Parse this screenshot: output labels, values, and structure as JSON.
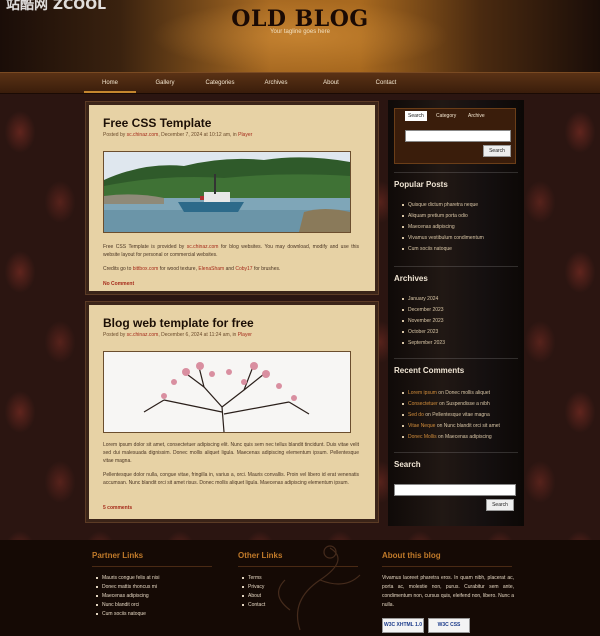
{
  "header": {
    "watermark": "站酷网 ZCOOL",
    "title": "OLD BLOG",
    "tagline": "Your tagline goes here"
  },
  "nav": [
    "Home",
    "Gallery",
    "Categories",
    "Archives",
    "About",
    "Contact"
  ],
  "posts": [
    {
      "title": "Free CSS Template",
      "meta_prefix": "Posted by ",
      "author": "sc.chinaz.com",
      "meta_date": ", December 7, 2024 at 10:12 am, in ",
      "category": "Player",
      "body1_prefix": "Free CSS Template is provided by ",
      "body1_link": "sc.chinaz.com",
      "body1_suffix": " for blog websites. You may download, modify and use this website layout for personal or commercial websites.",
      "credits_prefix": "Credits go to ",
      "credits_link1": "bittbox.com",
      "credits_mid": " for wood texture, ",
      "credits_link2": "ElenaSham",
      "credits_and": " and ",
      "credits_link3": "Coby17",
      "credits_suffix": " for brushes.",
      "comments": "No Comment"
    },
    {
      "title": "Blog web template for free",
      "meta_prefix": "Posted by ",
      "author": "sc.chinaz.com",
      "meta_date": ", December 6, 2024 at 11:24 am, in ",
      "category": "Player",
      "body1": "Lorem ipsum dolor sit amet, consectetuer adipiscing elit. Nunc quis sem nec tellus blandit tincidunt. Duis vitae velit sed dui malesuada dignissim. Donec mollis aliquet ligula. Maecenas adipiscing elementum ipsum. Pellentesque vitae magna.",
      "body2": "Pellentesque dolor nulla, congue vitae, fringilla in, varius a, orci. Mauris convallis. Proin vel libero id erat venenatis accumsan. Nunc blandit orci sit amet risus. Donec mollis aliquet ligula. Maecenas adipiscing elementum ipsum.",
      "comments": "5 comments"
    }
  ],
  "sidebar": {
    "tabs": [
      "Search",
      "Category",
      "Archive"
    ],
    "search_button": "Search",
    "popular_title": "Popular Posts",
    "popular": [
      "Quisque dictum pharetra neque",
      "Aliquam pretium porta odio",
      "Maecenas adipiscing",
      "Vivamus vestibulum condimentum",
      "Cum sociis natoque"
    ],
    "archives_title": "Archives",
    "archives": [
      "January 2024",
      "December 2023",
      "November 2023",
      "October 2023",
      "September 2023"
    ],
    "comments_title": "Recent Comments",
    "comments": [
      {
        "who": "Lorem ipsum",
        "on": " on ",
        "post": "Donec mollis aliquet"
      },
      {
        "who": "Consectetuer",
        "on": " on ",
        "post": "Suspendisse a nibh"
      },
      {
        "who": "Sed do",
        "on": " on ",
        "post": "Pellentesque vitae magna"
      },
      {
        "who": "Vitae Neque",
        "on": " on ",
        "post": "Nunc blandit orci sit amet"
      },
      {
        "who": "Donec Mollis",
        "on": " on ",
        "post": "Maecenas adipiscing"
      }
    ],
    "search_title": "Search",
    "search2_button": "Search"
  },
  "footer": {
    "partner_title": "Partner Links",
    "partner": [
      "Mauris congue felis at nisi",
      "Donec mattis rhoncus mi",
      "Maecenas adipiscing",
      "Nunc blandit orci",
      "Cum sociis natoque"
    ],
    "other_title": "Other Links",
    "other": [
      "Terms",
      "Privacy",
      "About",
      "Contact"
    ],
    "about_title": "About this blog",
    "about_text": "Vivamus laoreet pharetra eros. In quam nibh, placerat ac, porta ac, molestie non, purus. Curabitur sem ante, condimentum non, cursus quis, eleifend non, libero. Nunc a nulla.",
    "badge1": "W3C XHTML 1.0",
    "badge2": "W3C CSS"
  }
}
